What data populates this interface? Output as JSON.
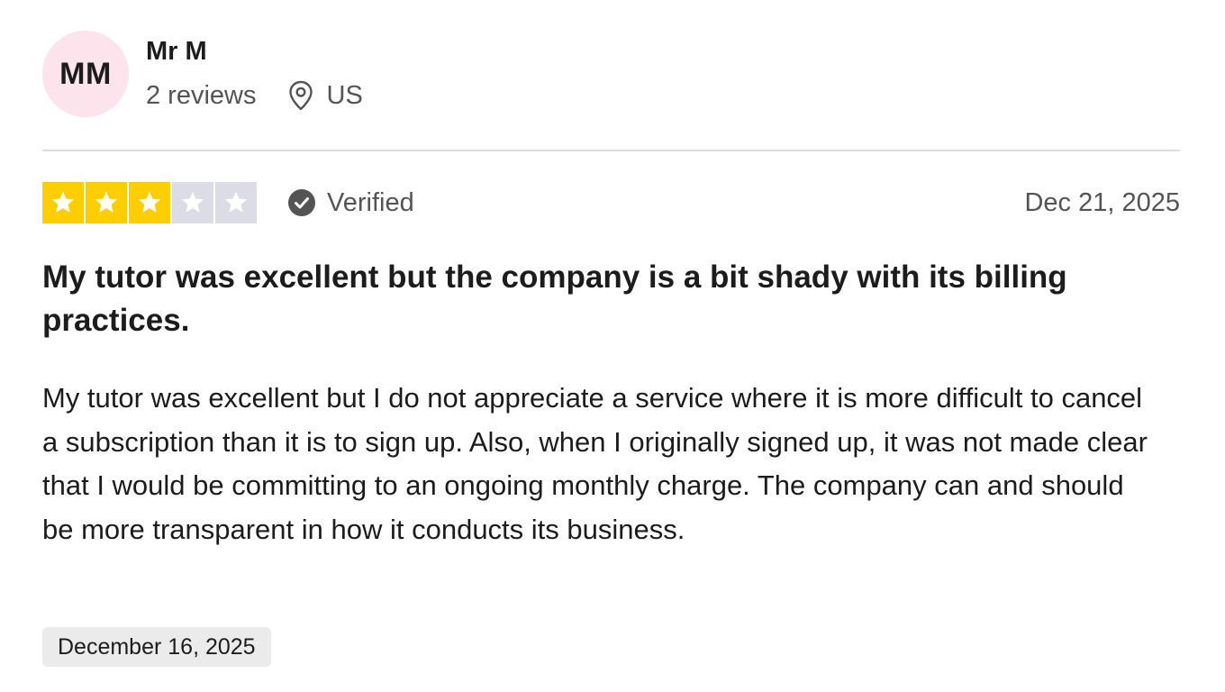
{
  "reviewer": {
    "initials": "MM",
    "name": "Mr M",
    "reviews_count": "2 reviews",
    "country": "US",
    "avatar_color": "#fde3ec"
  },
  "review": {
    "rating": 3,
    "max_rating": 5,
    "star_filled_color": "#ffce00",
    "star_empty_color": "#dcdce6",
    "verified_label": "Verified",
    "date": "Dec 21, 2025",
    "title": "My tutor was excellent but the company is a bit shady with its billing practices.",
    "body": "My tutor was excellent but I do not appreciate a service where it is more difficult to cancel a subscription than it is to sign up. Also, when I originally signed up, it was not made clear that I would be committing to an ongoing monthly charge. The company can and should be more transparent in how it conducts its business.",
    "experience_date": "December 16, 2025"
  },
  "icons": {
    "location": "map-pin-icon",
    "verified": "check-circle-icon",
    "star": "star-icon"
  }
}
